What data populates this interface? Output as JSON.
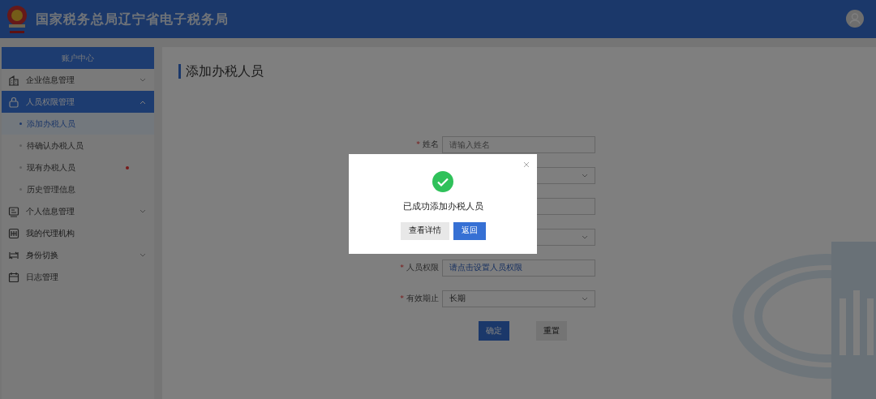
{
  "header": {
    "title": "国家税务总局辽宁省电子税务局"
  },
  "sidebar": {
    "title": "账户中心",
    "items": [
      {
        "label": "企业信息管理",
        "expanded": false,
        "selected": false
      },
      {
        "label": "人员权限管理",
        "expanded": true,
        "selected": true,
        "children": [
          {
            "label": "添加办税人员",
            "selected": true,
            "unread": false
          },
          {
            "label": "待确认办税人员",
            "selected": false,
            "unread": false
          },
          {
            "label": "现有办税人员",
            "selected": false,
            "unread": true
          },
          {
            "label": "历史管理信息",
            "selected": false,
            "unread": false
          }
        ]
      },
      {
        "label": "个人信息管理",
        "expanded": false,
        "selected": false
      },
      {
        "label": "我的代理机构",
        "selected": false
      },
      {
        "label": "身份切换",
        "expanded": false,
        "selected": false
      },
      {
        "label": "日志管理",
        "selected": false
      }
    ]
  },
  "page": {
    "title": "添加办税人员",
    "fields": [
      {
        "kind": "input",
        "label": "姓名",
        "required_mark": "*",
        "placeholder": "请输入姓名"
      },
      {
        "kind": "select"
      },
      {
        "kind": "input"
      },
      {
        "kind": "select"
      },
      {
        "kind": "link",
        "label": "人员权限",
        "required_mark": "*",
        "value": "请点击设置人员权限"
      },
      {
        "kind": "select",
        "label": "有效期止",
        "required_mark": "*",
        "value": "长期"
      }
    ],
    "buttons": [
      {
        "label": "确定",
        "kind": "primary"
      },
      {
        "label": "重置",
        "kind": "secondary"
      }
    ]
  },
  "modal": {
    "message": "已成功添加办税人员",
    "buttons": [
      {
        "label": "查看详情",
        "kind": "secondary"
      },
      {
        "label": "返回",
        "kind": "primary"
      }
    ]
  }
}
